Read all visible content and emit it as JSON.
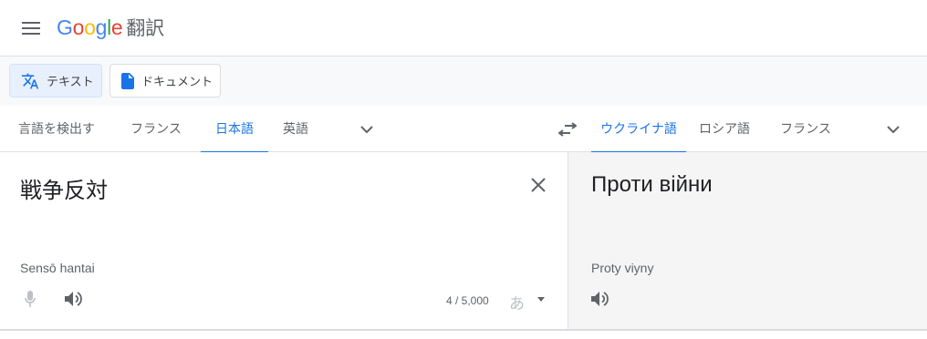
{
  "header": {
    "logo": {
      "letters": [
        "G",
        "o",
        "o",
        "g",
        "l",
        "e"
      ],
      "colors": [
        "#4285F4",
        "#EA4335",
        "#FBBC05",
        "#4285F4",
        "#34A853",
        "#EA4335"
      ]
    },
    "product_name": "翻訳",
    "menu_icon": "hamburger-menu-icon"
  },
  "modes": {
    "text_label": "テキスト",
    "text_icon": "translate-icon",
    "documents_label": "ドキュメント",
    "documents_icon": "document-icon"
  },
  "source_languages": {
    "detect": "言語を検出する",
    "items": [
      "フランス語",
      "日本語",
      "英語"
    ],
    "selected": "日本語",
    "more_icon": "chevron-down-icon"
  },
  "swap_icon": "swap-arrows-icon",
  "target_languages": {
    "items": [
      "ウクライナ語",
      "ロシア語",
      "フランス語"
    ],
    "selected": "ウクライナ語",
    "more_icon": "chevron-down-icon"
  },
  "source": {
    "text": "戦争反対",
    "romanization": "Sensō hantai",
    "char_count": "4 / 5,000",
    "ime_label": "あ",
    "clear_icon": "close-icon",
    "mic_icon": "microphone-icon",
    "speaker_icon": "speaker-icon"
  },
  "target": {
    "text": "Проти війни",
    "transliteration": "Proty viyny",
    "speaker_icon": "speaker-icon"
  },
  "colors": {
    "accent": "#1a73e8",
    "active_mode_bg": "#e8f0fe",
    "target_bg": "#f5f5f5"
  }
}
